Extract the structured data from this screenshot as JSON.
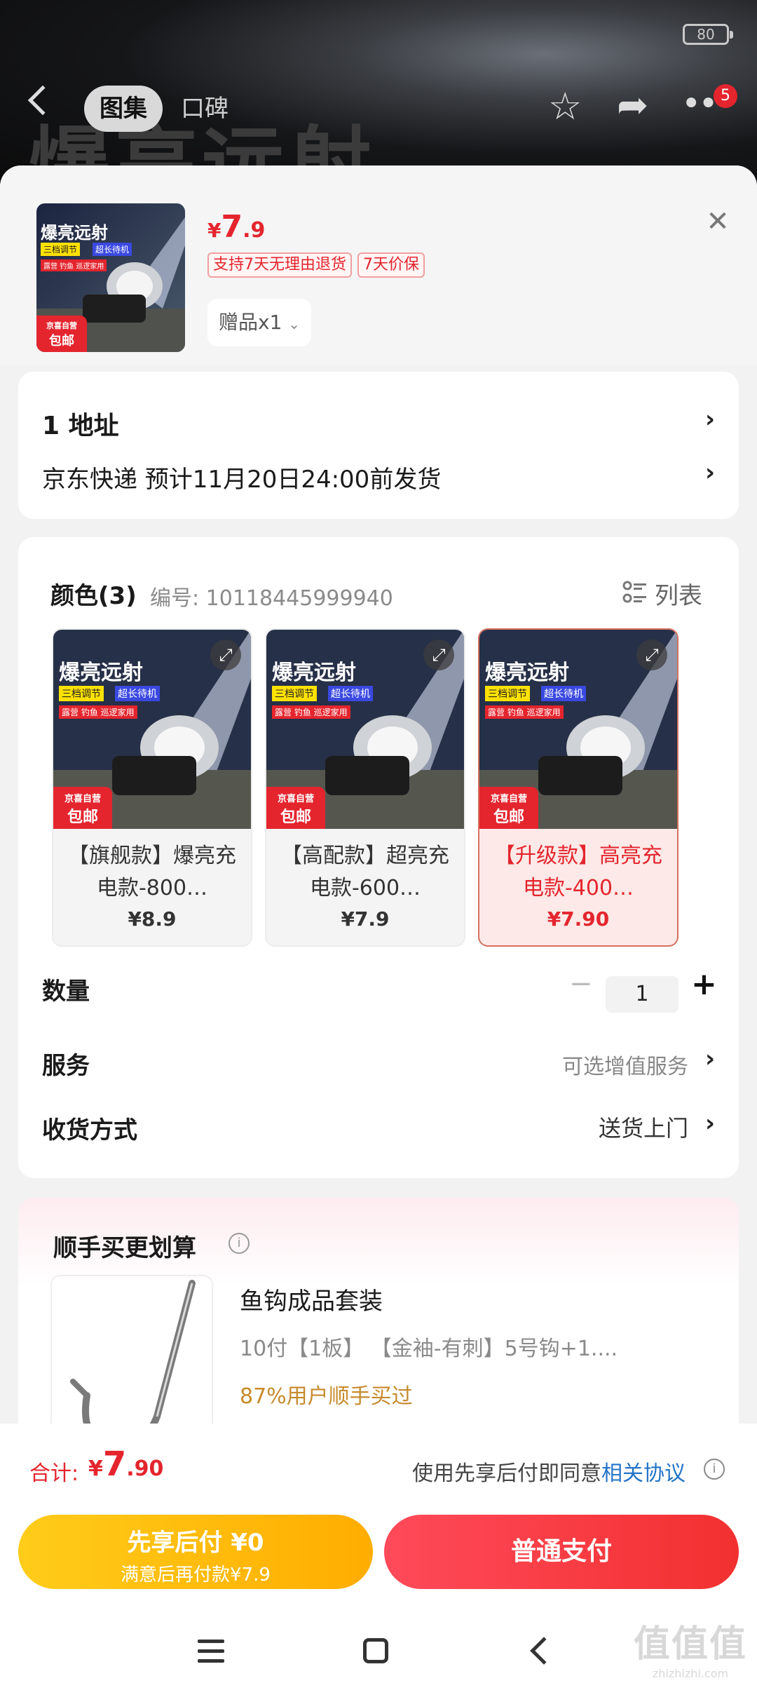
{
  "status": {
    "battery": "80"
  },
  "background": {
    "hero_text": "爆亮远射",
    "tabs": [
      "图集",
      "口碑"
    ],
    "cart_badge": "5"
  },
  "product": {
    "price_currency": "¥",
    "price_int": "7",
    "price_dec": ".9",
    "tags": [
      "支持7天无理由退货",
      "7天价保"
    ],
    "gift": "赠品x1",
    "art": {
      "title": "爆亮远射",
      "chip1": "三档调节",
      "chip2": "超长待机",
      "chip3": "露营 钓鱼 巡逻家用",
      "badge_top": "京喜自营",
      "badge_bottom": "包邮"
    }
  },
  "address": {
    "line1": "1  地址",
    "line2": "京东快递 预计11月20日24:00前发货"
  },
  "options": {
    "title": "颜色(3)",
    "code": "编号: 10118445999940",
    "list_label": "列表",
    "variants": [
      {
        "name": "【旗舰款】爆亮充电款-800…",
        "price": "¥8.9"
      },
      {
        "name": "【高配款】超亮充电款-600…",
        "price": "¥7.9"
      },
      {
        "name": "【升级款】高亮充电款-400…",
        "price": "¥7.90"
      }
    ],
    "quantity_label": "数量",
    "quantity_value": "1",
    "minus": "−",
    "plus": "+",
    "service_label": "服务",
    "service_value": "可选增值服务",
    "delivery_label": "收货方式",
    "delivery_value": "送货上门"
  },
  "upsell": {
    "title": "顺手买更划算",
    "name": "鱼钩成品套装",
    "spec": "10付【1板】 【金袖-有刺】5号钩+1....",
    "hint": "87%用户顺手买过"
  },
  "footer": {
    "total_label": "合计:",
    "total_currency": "¥",
    "total_int": "7",
    "total_dec": ".90",
    "agree_text": "使用先享后付即同意",
    "agree_link": "相关协议",
    "btn_later_line1": "先享后付 ¥0",
    "btn_later_line2": "满意后再付款¥7.9",
    "btn_pay": "普通支付"
  },
  "watermark": {
    "line1": "值值值",
    "line2": "zhizhizhi.com"
  },
  "colors": {
    "accent_red": "#e4252e",
    "accent_yellow": "#ffb300",
    "link_blue": "#2474c9"
  }
}
